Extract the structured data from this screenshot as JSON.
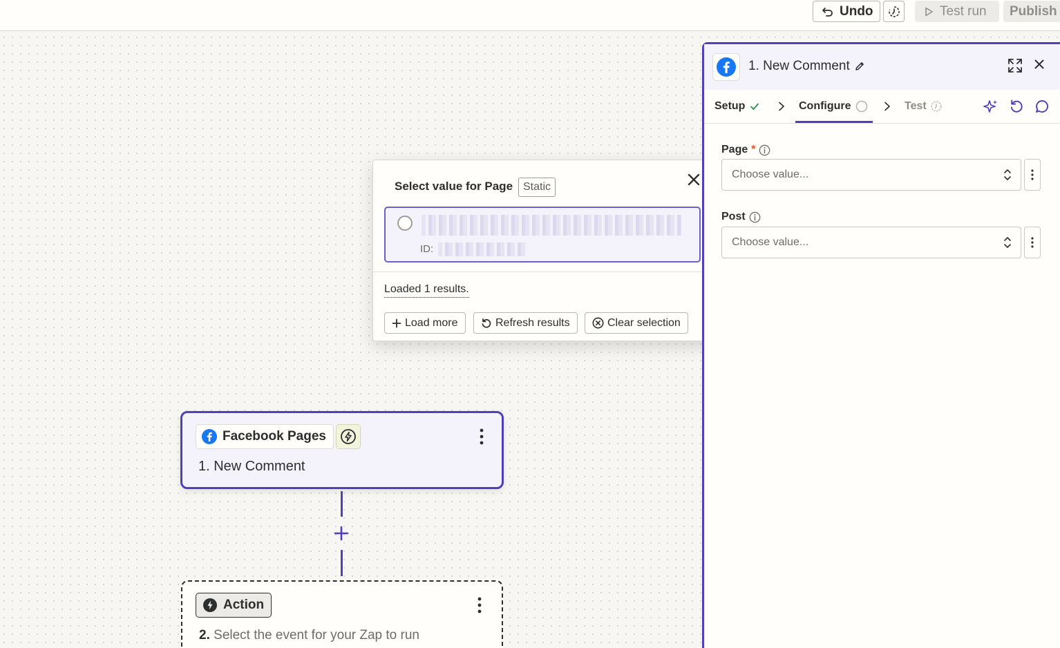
{
  "toolbar": {
    "undo_label": "Undo",
    "test_run_label": "Test run",
    "publish_label": "Publish"
  },
  "trigger_node": {
    "app_name": "Facebook Pages",
    "title": "1. New Comment"
  },
  "action_node": {
    "chip_label": "Action",
    "step_number": "2.",
    "description": "Select the event for your Zap to run"
  },
  "popover": {
    "title": "Select value for Page",
    "badge": "Static",
    "option_id_label": "ID:",
    "loaded_text": "Loaded 1 results.",
    "load_more_label": "Load more",
    "refresh_label": "Refresh results",
    "clear_label": "Clear selection"
  },
  "panel": {
    "title": "1. New Comment",
    "tabs": [
      {
        "label": "Setup",
        "status": "complete"
      },
      {
        "label": "Configure",
        "status": "active"
      },
      {
        "label": "Test",
        "status": "pending"
      }
    ],
    "fields": [
      {
        "label": "Page",
        "required": true,
        "placeholder": "Choose value..."
      },
      {
        "label": "Post",
        "required": false,
        "placeholder": "Choose value..."
      }
    ]
  },
  "colors": {
    "accent": "#503ebd",
    "facebook": "#1877f2",
    "success": "#2e8b57",
    "required": "#e5542b"
  }
}
